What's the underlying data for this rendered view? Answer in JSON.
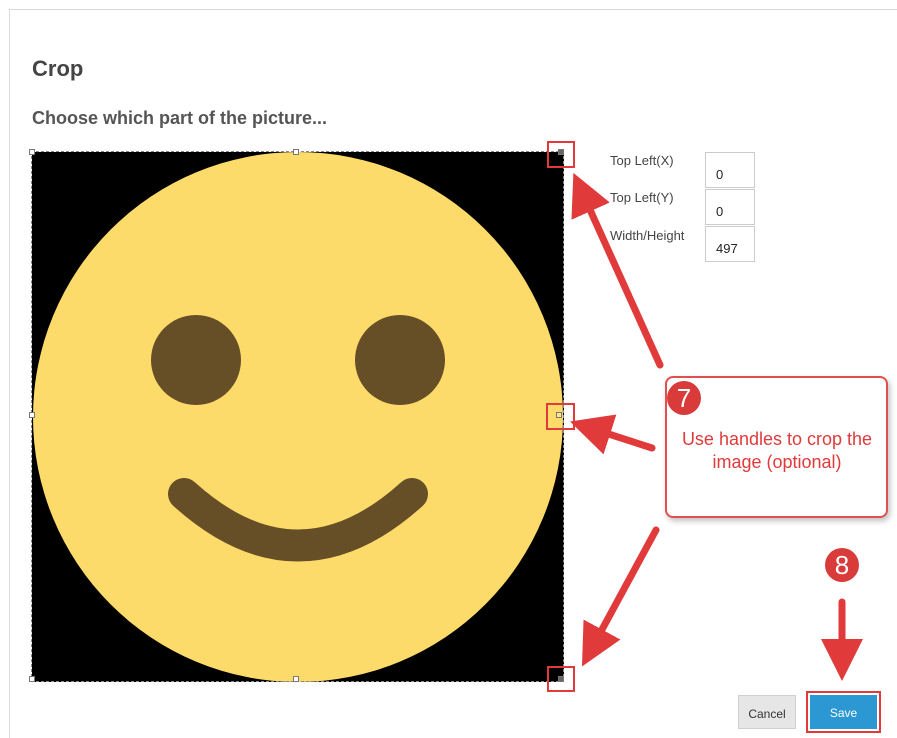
{
  "dialog": {
    "title": "Crop",
    "subtitle": "Choose which part of the picture..."
  },
  "crop_fields": [
    {
      "label": "Top Left(X)",
      "value": "0"
    },
    {
      "label": "Top Left(Y)",
      "value": "0"
    },
    {
      "label": "Width/Height",
      "value": "497"
    }
  ],
  "callout": {
    "step": "7",
    "text": "Use handles to crop the image (optional)"
  },
  "save_step": "8",
  "buttons": {
    "cancel": "Cancel",
    "save": "Save"
  },
  "colors": {
    "annotation_red": "#e03a3a",
    "save_blue": "#2b98d4",
    "smiley_yellow": "#fddb6a",
    "smiley_features": "#664e27"
  },
  "image_icon": "smiley-face-icon"
}
